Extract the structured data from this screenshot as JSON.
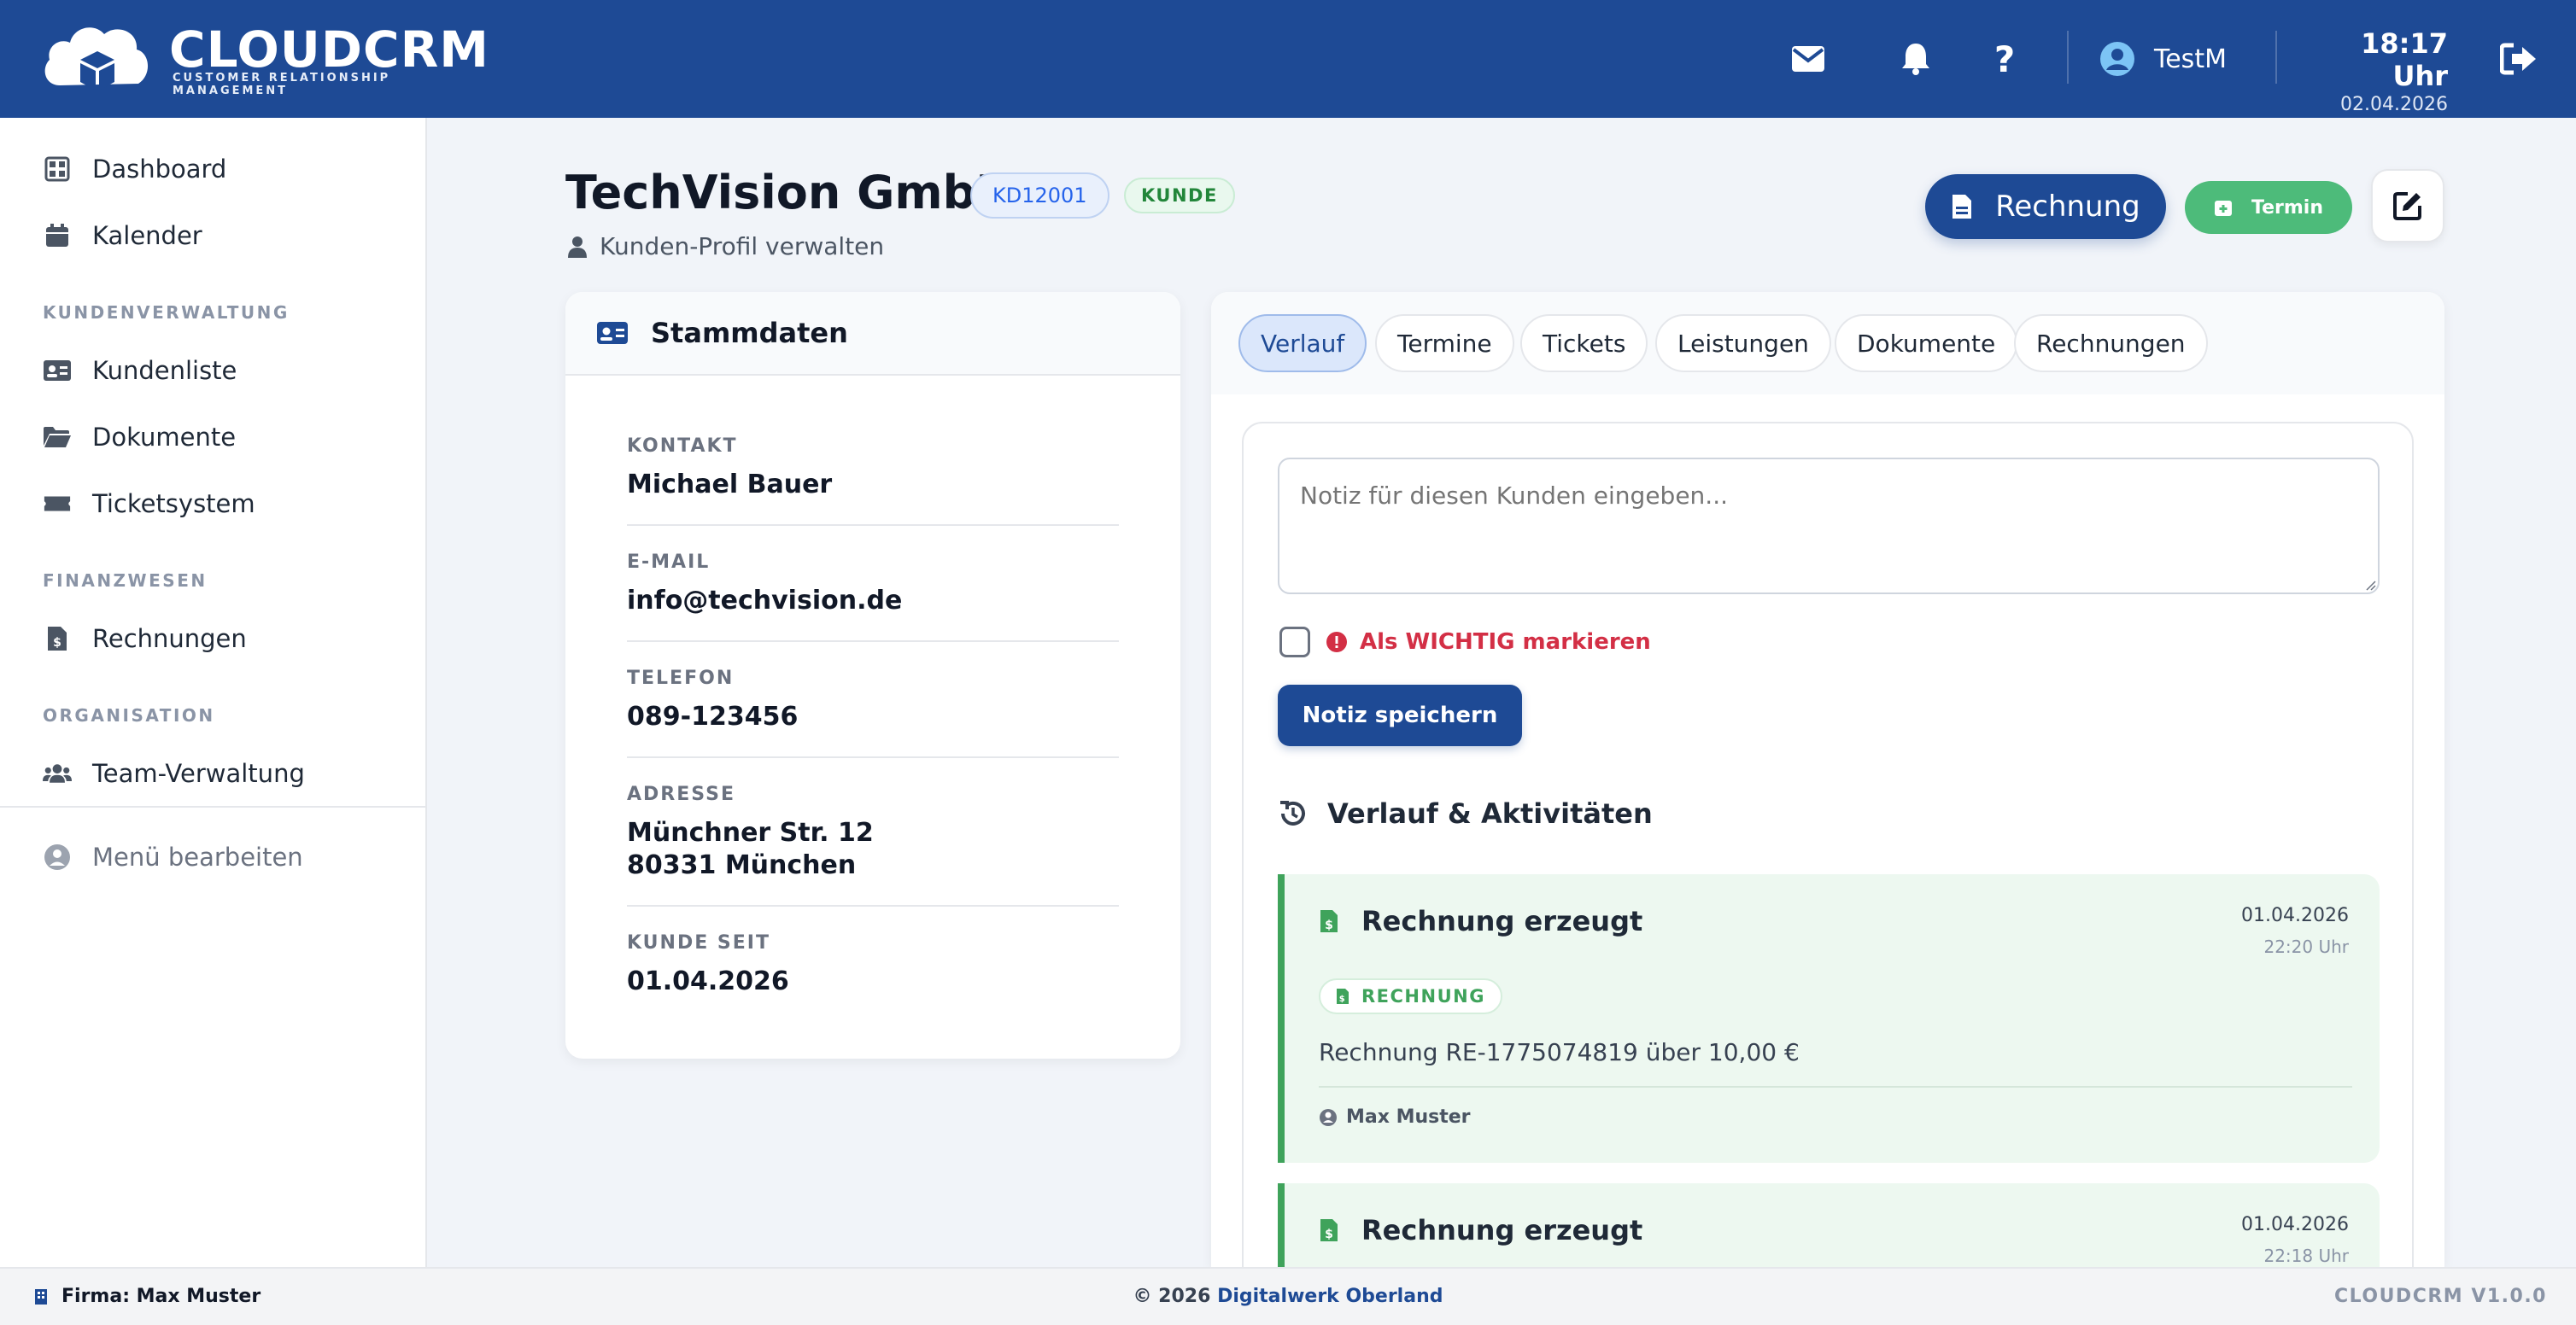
{
  "app": {
    "logo_title": "CLOUDCRM",
    "logo_subtitle": "CUSTOMER RELATIONSHIP MANAGEMENT",
    "accent_color": "#1e4a95"
  },
  "header": {
    "icons": [
      "mail-icon",
      "bell-icon",
      "help-icon",
      "user-circle-icon",
      "logout-icon"
    ],
    "username": "TestM",
    "time": "18:17 Uhr",
    "date": "02.04.2026"
  },
  "sidebar": {
    "items": [
      {
        "label": "Dashboard",
        "icon": "grid-icon"
      },
      {
        "label": "Kalender",
        "icon": "calendar-icon"
      },
      {
        "label": "Kundenliste",
        "icon": "id-card-icon"
      },
      {
        "label": "Dokumente",
        "icon": "folder-icon"
      },
      {
        "label": "Ticketsystem",
        "icon": "ticket-icon"
      },
      {
        "label": "Rechnungen",
        "icon": "invoice-icon"
      },
      {
        "label": "Team-Verwaltung",
        "icon": "users-icon"
      },
      {
        "label": "Menü bearbeiten",
        "icon": "user-circle-icon"
      }
    ],
    "sections": [
      "KUNDENVERWALTUNG",
      "FINANZWESEN",
      "ORGANISATION"
    ]
  },
  "page": {
    "title": "TechVision GmbH",
    "customer_id": "KD12001",
    "status_badge": "KUNDE",
    "subtitle": "Kunden-Profil verwalten",
    "btn_rechnung": "Rechnung",
    "btn_termin": "Termin"
  },
  "stammdaten": {
    "title": "Stammdaten",
    "fields": [
      {
        "label": "KONTAKT",
        "value": "Michael Bauer"
      },
      {
        "label": "E-MAIL",
        "value": "info@techvision.de"
      },
      {
        "label": "TELEFON",
        "value": "089-123456"
      },
      {
        "label": "ADRESSE",
        "value": "Münchner Str. 12",
        "value2": "80331 München"
      },
      {
        "label": "KUNDE SEIT",
        "value": "01.04.2026"
      }
    ]
  },
  "tabs": [
    "Verlauf",
    "Termine",
    "Tickets",
    "Leistungen",
    "Dokumente",
    "Rechnungen"
  ],
  "active_tab": "Verlauf",
  "note": {
    "placeholder": "Notiz für diesen Kunden eingeben...",
    "important_label": "Als WICHTIG markieren",
    "important_checked": false,
    "save_label": "Notiz speichern"
  },
  "history": {
    "title": "Verlauf & Aktivitäten",
    "entries": [
      {
        "title": "Rechnung erzeugt",
        "date": "01.04.2026",
        "time": "22:20 Uhr",
        "badge": "RECHNUNG",
        "text": "Rechnung RE-1775074819 über 10,00 €",
        "author": "Max Muster"
      },
      {
        "title": "Rechnung erzeugt",
        "date": "01.04.2026",
        "time": "22:18 Uhr"
      }
    ]
  },
  "footer": {
    "company": "Firma: Max Muster",
    "copyright": "© 2026",
    "copyright_link": "Digitalwerk Oberland",
    "version": "CLOUDCRM V1.0.0"
  }
}
